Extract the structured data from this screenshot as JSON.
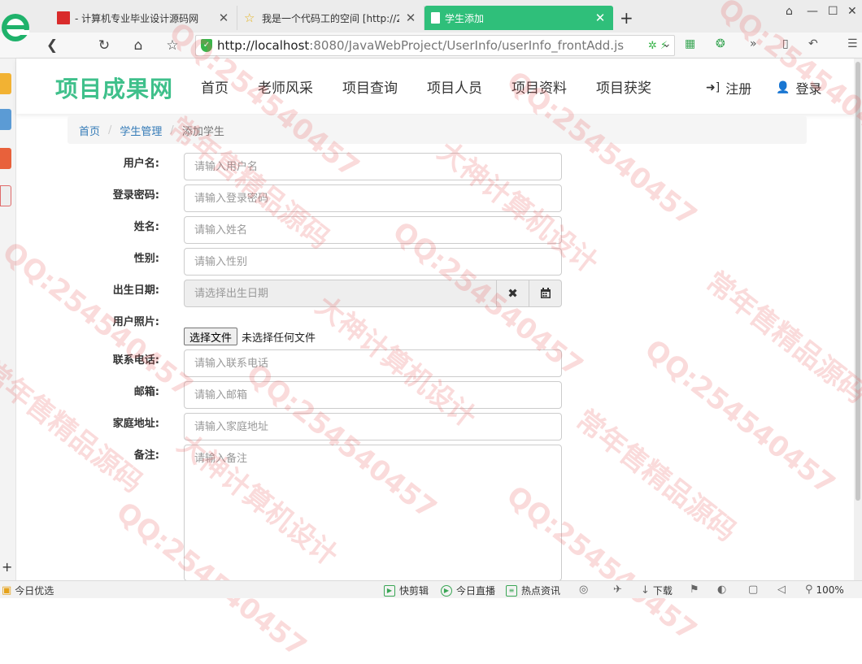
{
  "browser": {
    "tabs": [
      {
        "title": "- 计算机专业毕业设计源码网",
        "active": false
      },
      {
        "title": "我是一个代码工的空间 [http://2",
        "active": false
      },
      {
        "title": "学生添加",
        "active": true
      }
    ],
    "new_tab": "+",
    "url_host": "http://localhost",
    "url_path": ":8080/JavaWebProject/UserInfo/userInfo_frontAdd.js",
    "accent": "#2fbf7a"
  },
  "site": {
    "brand": "项目成果网",
    "brand_color": "#3fc08b",
    "menu": [
      "首页",
      "老师风采",
      "项目查询",
      "项目人员",
      "项目资料",
      "项目获奖"
    ],
    "register": "注册",
    "login": "登录"
  },
  "breadcrumb": {
    "home": "首页",
    "section": "学生管理",
    "current": "添加学生",
    "separator": "/"
  },
  "form": {
    "username": {
      "label": "用户名:",
      "placeholder": "请输入用户名"
    },
    "password": {
      "label": "登录密码:",
      "placeholder": "请输入登录密码"
    },
    "name": {
      "label": "姓名:",
      "placeholder": "请输入姓名"
    },
    "gender": {
      "label": "性别:",
      "placeholder": "请输入性别"
    },
    "birthday": {
      "label": "出生日期:",
      "placeholder": "请选择出生日期"
    },
    "photo": {
      "label": "用户照片:",
      "button": "选择文件",
      "status": "未选择任何文件"
    },
    "phone": {
      "label": "联系电话:",
      "placeholder": "请输入联系电话"
    },
    "email": {
      "label": "邮箱:",
      "placeholder": "请输入邮箱"
    },
    "address": {
      "label": "家庭地址:",
      "placeholder": "请输入家庭地址"
    },
    "memo": {
      "label": "备注:",
      "placeholder": "请输入备注"
    }
  },
  "statusbar": {
    "today": "今日优选",
    "clip": "快剪辑",
    "live": "今日直播",
    "news": "热点资讯",
    "download": "下载",
    "zoom": "100%"
  },
  "watermark": [
    "QQ:254540457",
    "大神计算机设计",
    "常年售精品源码"
  ]
}
